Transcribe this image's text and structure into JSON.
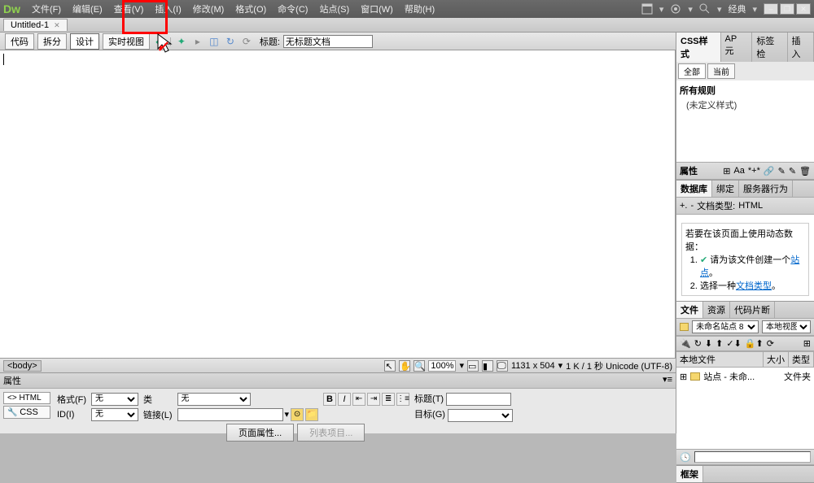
{
  "app": {
    "logo": "Dw",
    "layout_name": "经典"
  },
  "menu": [
    "文件(F)",
    "编辑(E)",
    "查看(V)",
    "插入(I)",
    "修改(M)",
    "格式(O)",
    "命令(C)",
    "站点(S)",
    "窗口(W)",
    "帮助(H)"
  ],
  "doc_tab": {
    "name": "Untitled-1"
  },
  "toolbar": {
    "views": {
      "code": "代码",
      "split": "拆分",
      "design": "设计",
      "live": "实时视图"
    },
    "title_label": "标题:",
    "title_value": "无标题文档"
  },
  "status": {
    "tag": "<body>",
    "zoom": "100%",
    "dims": "1131 x 504",
    "info": "1 K / 1 秒 Unicode (UTF-8)"
  },
  "props": {
    "header": "属性",
    "tabs": {
      "html": "<> HTML",
      "css": "CSS"
    },
    "format_label": "格式(F)",
    "format_value": "无",
    "id_label": "ID(I)",
    "id_value": "无",
    "class_label": "类",
    "class_value": "无",
    "link_label": "链接(L)",
    "title_label": "标题(T)",
    "target_label": "目标(G)",
    "page_props_btn": "页面属性...",
    "list_item_btn": "列表项目..."
  },
  "panels": {
    "css": {
      "tabs": [
        "CSS样式",
        "AP 元",
        "标签检",
        "插入"
      ],
      "subtabs": {
        "all": "全部",
        "current": "当前"
      },
      "rules_header": "所有规则",
      "no_rules": "(未定义样式)"
    },
    "attr": {
      "header": "属性"
    },
    "db": {
      "tabs": [
        "数据库",
        "绑定",
        "服务器行为"
      ],
      "doc_type_label": "文档类型:",
      "doc_type": "HTML",
      "msg_intro": "若要在该页面上使用动态数据：",
      "step1a": "请为该文件创建一个",
      "step1b": "站点",
      "step1c": "。",
      "step2a": "选择一种",
      "step2b": "文档类型",
      "step2c": "。"
    },
    "files": {
      "tabs": [
        "文件",
        "资源",
        "代码片断"
      ],
      "site": "未命名站点 8",
      "view": "本地视图",
      "cols": {
        "name": "本地文件",
        "size": "大小",
        "type": "类型"
      },
      "root_label": "站点 - 未命...",
      "root_type": "文件夹"
    },
    "frames": {
      "header": "框架"
    }
  }
}
